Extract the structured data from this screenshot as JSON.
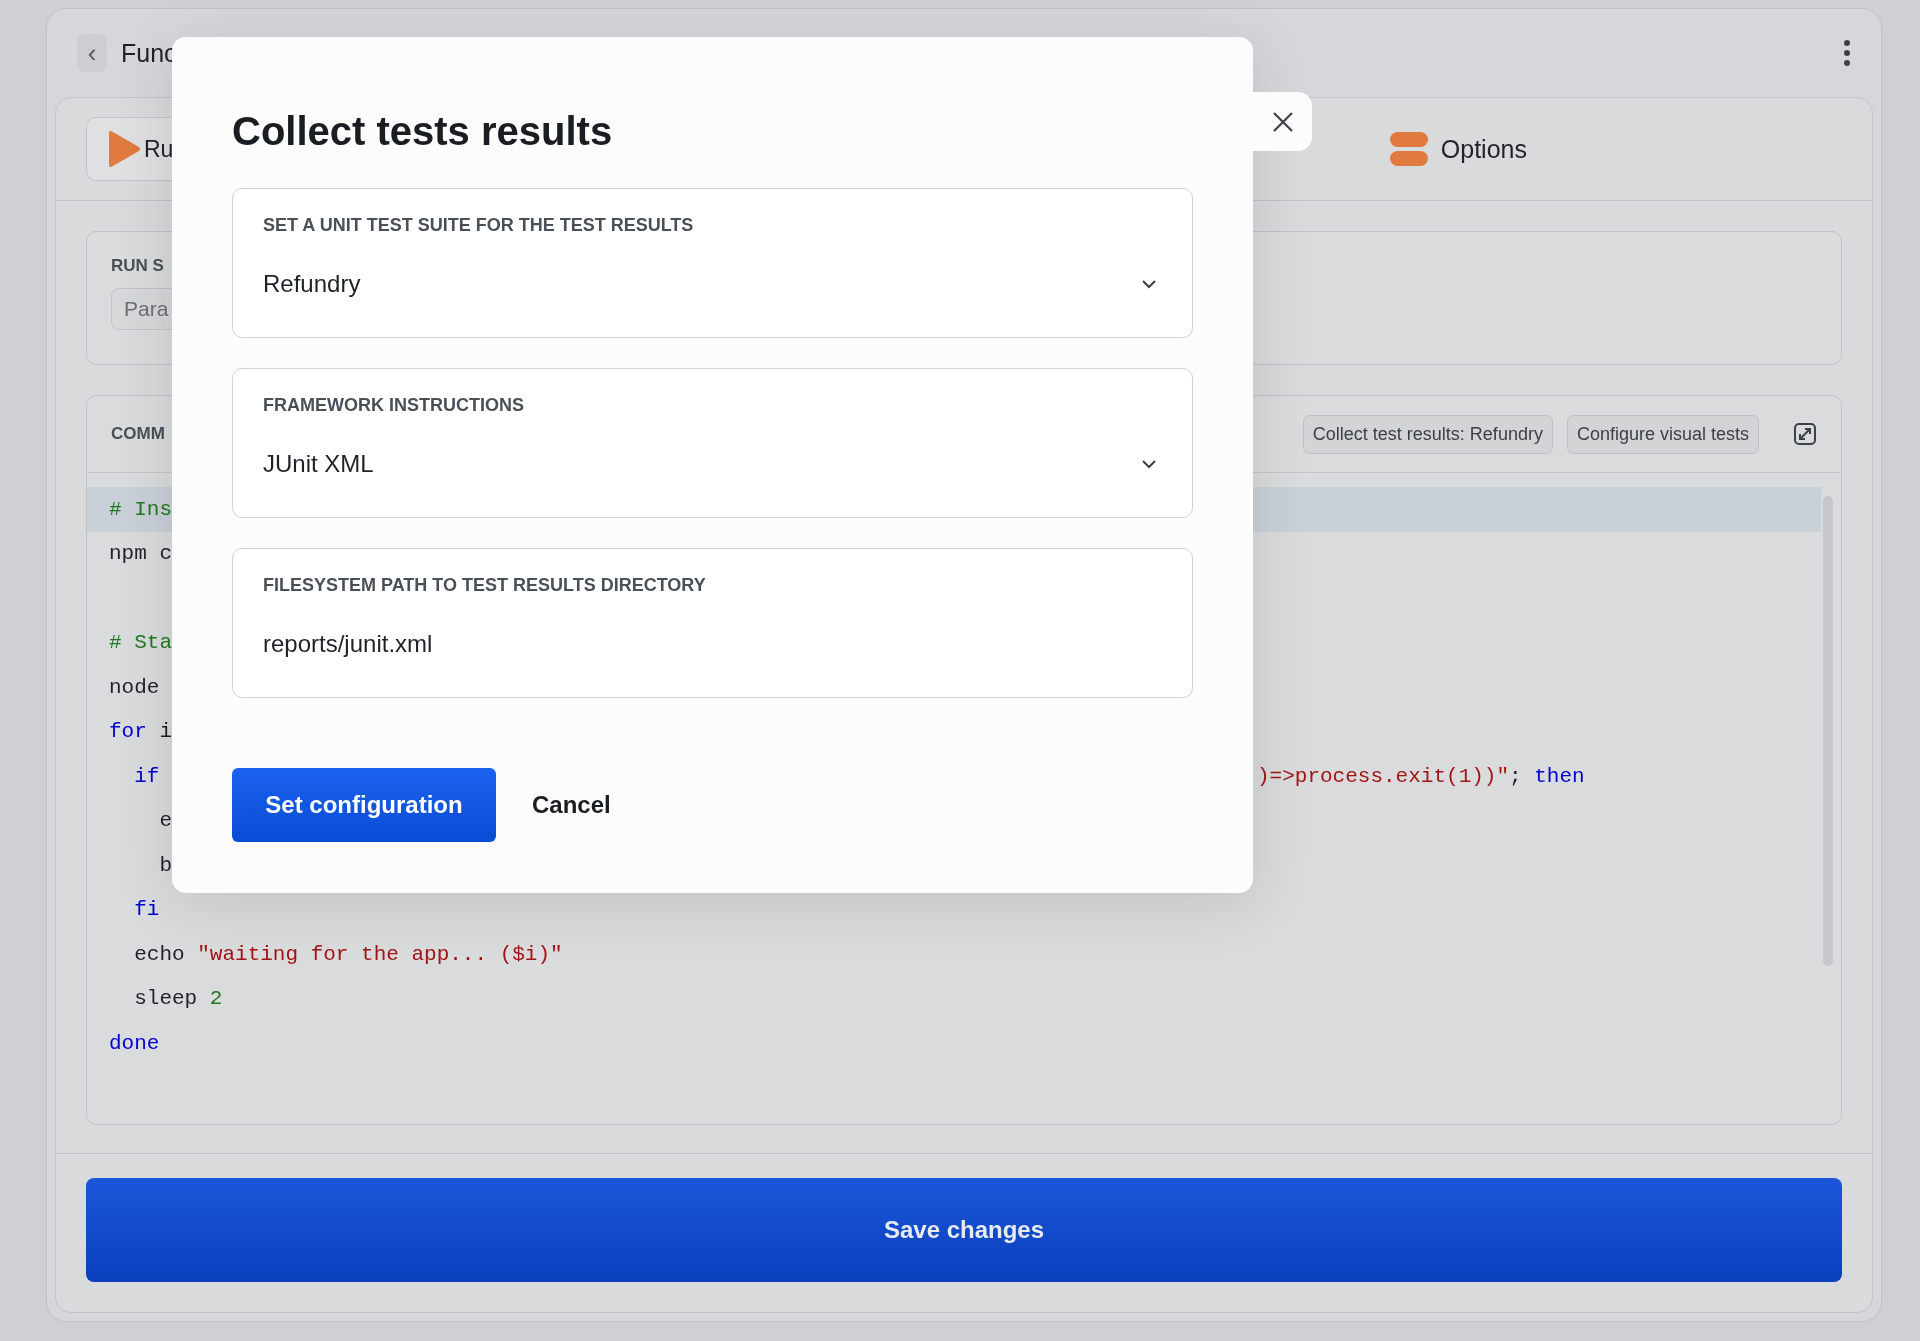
{
  "header": {
    "back": "‹",
    "title": "Func"
  },
  "tabs": [
    {
      "label": "Ru",
      "kind": "play",
      "selected": true
    },
    {
      "label": "Options",
      "kind": "toggles",
      "selected": false
    }
  ],
  "run_section": {
    "label": "RUN S",
    "field_value": "Para"
  },
  "commands": {
    "label": "COMM",
    "chips": [
      "Collect test results: Refundry",
      "Configure visual tests"
    ],
    "lines": [
      {
        "highlighted": true,
        "left": [
          {
            "kind": "comment",
            "text": "# Ins"
          }
        ]
      },
      {
        "highlighted": false,
        "left": [
          {
            "kind": "plain",
            "text": "npm c"
          }
        ]
      },
      {
        "highlighted": false
      },
      {
        "highlighted": false,
        "left": [
          {
            "kind": "comment",
            "text": "# Sta"
          }
        ]
      },
      {
        "highlighted": false,
        "left": [
          {
            "kind": "plain",
            "text": "node"
          }
        ]
      },
      {
        "highlighted": false,
        "left": [
          {
            "kind": "keyword",
            "text": "for"
          },
          {
            "kind": "plain",
            "text": " i"
          }
        ]
      },
      {
        "highlighted": false,
        "left": [
          {
            "kind": "keyword",
            "text": "  if"
          }
        ],
        "right": [
          {
            "kind": "string",
            "text": ")=>process.exit(1))\""
          },
          {
            "kind": "plain",
            "text": "; "
          },
          {
            "kind": "keyword",
            "text": "then"
          }
        ]
      },
      {
        "highlighted": false,
        "left": [
          {
            "kind": "plain",
            "text": "    e"
          }
        ]
      },
      {
        "highlighted": false,
        "left": [
          {
            "kind": "plain",
            "text": "    b"
          }
        ]
      },
      {
        "highlighted": false,
        "left": [
          {
            "kind": "keyword",
            "text": "  fi"
          }
        ]
      },
      {
        "highlighted": false,
        "left": [
          {
            "kind": "plain",
            "text": "  echo "
          },
          {
            "kind": "string",
            "text": "\"waiting for the app... ($i)\""
          }
        ]
      },
      {
        "highlighted": false,
        "left": [
          {
            "kind": "plain",
            "text": "  sleep "
          },
          {
            "kind": "number",
            "text": "2"
          }
        ]
      },
      {
        "highlighted": false,
        "left": [
          {
            "kind": "keyword",
            "text": "done"
          }
        ]
      }
    ]
  },
  "save_button": "Save changes",
  "dialog": {
    "title": "Collect tests results",
    "fields": [
      {
        "kind": "select",
        "label": "SET A UNIT TEST SUITE FOR THE TEST RESULTS",
        "value": "Refundry"
      },
      {
        "kind": "select",
        "label": "FRAMEWORK INSTRUCTIONS",
        "value": "JUnit XML"
      },
      {
        "kind": "text",
        "label": "FILESYSTEM PATH TO TEST RESULTS DIRECTORY",
        "value": "reports/junit.xml"
      }
    ],
    "primary_button": "Set configuration",
    "cancel_button": "Cancel"
  }
}
